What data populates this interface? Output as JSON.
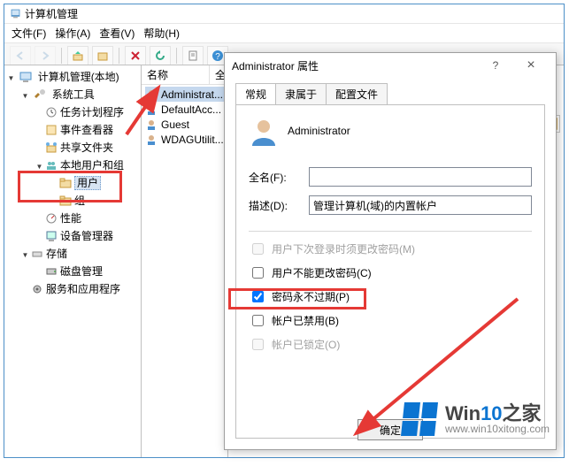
{
  "window": {
    "title": "计算机管理"
  },
  "menu": {
    "file": "文件(F)",
    "action": "操作(A)",
    "view": "查看(V)",
    "help": "帮助(H)"
  },
  "toolbar": {
    "btn1": "back-icon",
    "btn2": "forward-icon",
    "btn3": "up-icon",
    "btn4": "browse-icon",
    "btn5": "delete-icon",
    "btn6": "refresh-icon",
    "btn7": "properties-icon",
    "btn8": "help-icon"
  },
  "tree": {
    "root": "计算机管理(本地)",
    "system_tools": "系统工具",
    "task_scheduler": "任务计划程序",
    "event_viewer": "事件查看器",
    "shared_folders": "共享文件夹",
    "local_users": "本地用户和组",
    "users": "用户",
    "groups": "组",
    "performance": "性能",
    "device_manager": "设备管理器",
    "storage": "存储",
    "disk_mgmt": "磁盘管理",
    "services_apps": "服务和应用程序"
  },
  "list": {
    "header_name": "名称",
    "header_full": "全",
    "rows": [
      {
        "name": "Administrat..."
      },
      {
        "name": "DefaultAcc..."
      },
      {
        "name": "Guest"
      },
      {
        "name": "WDAGUtilit..."
      }
    ]
  },
  "dialog": {
    "title": "Administrator 属性",
    "help_btn": "?",
    "close_btn": "×",
    "tabs": {
      "general": "常规",
      "member_of": "隶属于",
      "profile": "配置文件"
    },
    "heading": "Administrator",
    "full_name_lbl": "全名(F):",
    "full_name_val": "",
    "desc_lbl": "描述(D):",
    "desc_val": "管理计算机(域)的内置帐户",
    "opt_must_change": "用户下次登录时须更改密码(M)",
    "opt_cannot_change": "用户不能更改密码(C)",
    "opt_never_expire": "密码永不过期(P)",
    "opt_disabled": "帐户已禁用(B)",
    "opt_locked": "帐户已锁定(O)",
    "ok": "确定"
  },
  "watermark": {
    "brand_win": "Win",
    "brand_10": "10",
    "brand_suffix": "之家",
    "url": "www.win10xitong.com"
  }
}
